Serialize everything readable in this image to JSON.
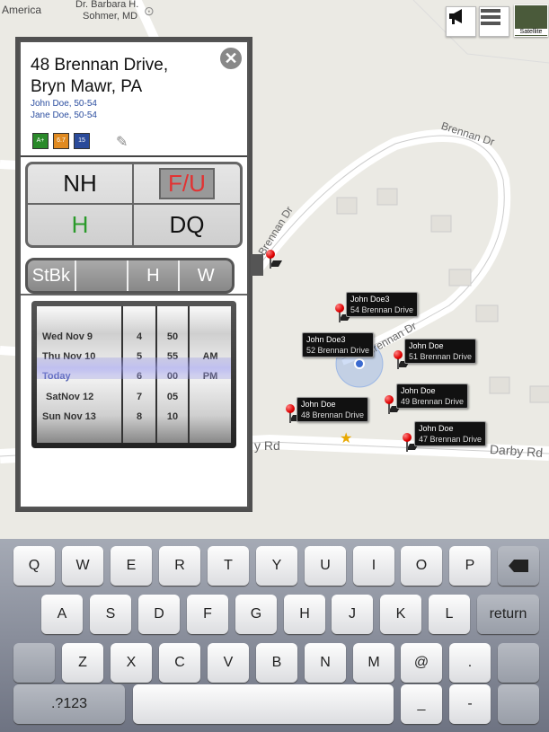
{
  "map": {
    "places": [
      "America",
      "Dr. Barbara H.",
      "Sohmer, MD"
    ],
    "roads": [
      "Brennan Dr",
      "Brennan Dr",
      "Brennan Dr",
      "Darby Rd",
      "y Rd"
    ],
    "satellite_label": "Satellite",
    "markers": [
      {
        "name": "John Doe3",
        "address": "54 Brennan Drive"
      },
      {
        "name": "John Doe3",
        "address": "52 Brennan Drive"
      },
      {
        "name": "John Doe",
        "address": "51 Brennan Drive"
      },
      {
        "name": "John Doe",
        "address": "48 Brennan Drive"
      },
      {
        "name": "John Doe",
        "address": "49 Brennan Drive"
      },
      {
        "name": "John Doe",
        "address": "47 Brennan Drive"
      }
    ]
  },
  "panel": {
    "address_line1": "48 Brennan Drive,",
    "address_line2": "Bryn Mawr, PA",
    "people": [
      "John Doe, 50-54",
      "Jane Doe, 50-54"
    ],
    "badges": [
      {
        "text": "A+",
        "color": "#2a8a2a"
      },
      {
        "text": "6.7",
        "color": "#e08a20"
      },
      {
        "text": "15",
        "color": "#2a4a9a"
      }
    ],
    "status": {
      "nh": "NH",
      "fu": "F/U",
      "h": "H",
      "dq": "DQ"
    },
    "tabs": {
      "stbk": "StBk",
      "blank": "",
      "h": "H",
      "w": "W"
    },
    "picker": {
      "days": [
        {
          "dow": "Wed",
          "date": "Nov 9"
        },
        {
          "dow": "Thu",
          "date": "Nov 10"
        },
        {
          "dow": "Today",
          "date": ""
        },
        {
          "dow": "Sat",
          "date": "Nov 12"
        },
        {
          "dow": "Sun",
          "date": "Nov 13"
        }
      ],
      "hours": [
        "4",
        "5",
        "6",
        "7",
        "8"
      ],
      "minutes": [
        "50",
        "55",
        "00",
        "05",
        "10"
      ],
      "ampm": [
        "",
        "AM",
        "PM",
        "",
        ""
      ]
    }
  },
  "keyboard": {
    "row1": [
      "Q",
      "W",
      "E",
      "R",
      "T",
      "Y",
      "U",
      "I",
      "O",
      "P"
    ],
    "row2": [
      "A",
      "S",
      "D",
      "F",
      "G",
      "H",
      "J",
      "K",
      "L"
    ],
    "return": "return",
    "row3": [
      "Z",
      "X",
      "C",
      "V",
      "B",
      "N",
      "M",
      "@",
      "."
    ],
    "numbers": ".?123",
    "underscore": "_",
    "dash": "-"
  }
}
